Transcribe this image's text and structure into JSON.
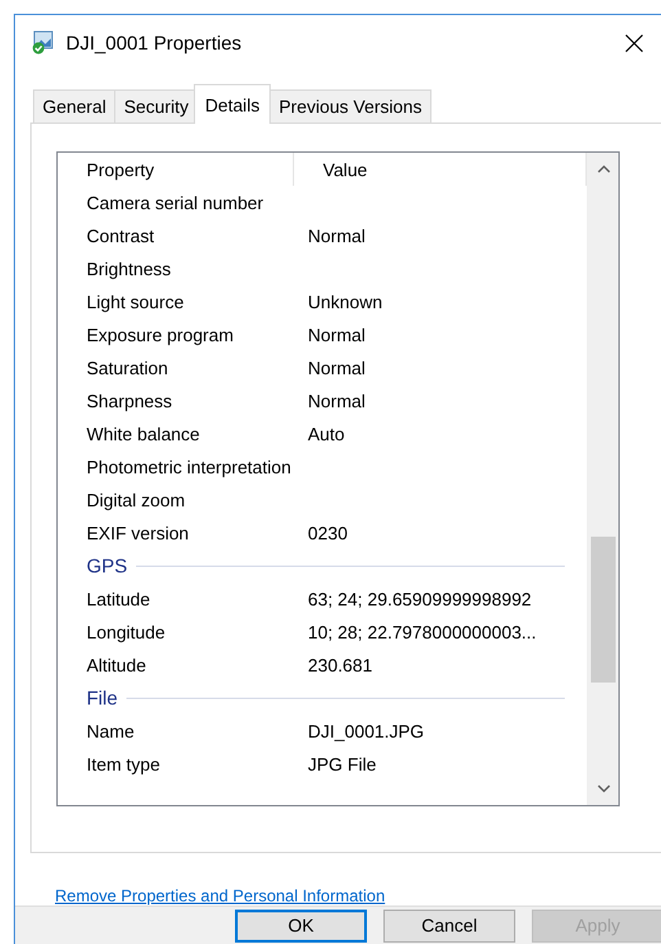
{
  "window": {
    "title": "DJI_0001 Properties"
  },
  "tabs": [
    {
      "label": "General",
      "selected": false
    },
    {
      "label": "Security",
      "selected": false
    },
    {
      "label": "Details",
      "selected": true
    },
    {
      "label": "Previous Versions",
      "selected": false
    }
  ],
  "details": {
    "columns": [
      "Property",
      "Value"
    ],
    "items": [
      {
        "kind": "row",
        "name": "Camera serial number"
      },
      {
        "kind": "row",
        "name": "Contrast",
        "value": "Normal"
      },
      {
        "kind": "row",
        "name": "Brightness"
      },
      {
        "kind": "row",
        "name": "Light source",
        "value": "Unknown"
      },
      {
        "kind": "row",
        "name": "Exposure program",
        "value": "Normal"
      },
      {
        "kind": "row",
        "name": "Saturation",
        "value": "Normal"
      },
      {
        "kind": "row",
        "name": "Sharpness",
        "value": "Normal"
      },
      {
        "kind": "row",
        "name": "White balance",
        "value": "Auto"
      },
      {
        "kind": "row",
        "name": "Photometric interpretation"
      },
      {
        "kind": "row",
        "name": "Digital zoom"
      },
      {
        "kind": "row",
        "name": "EXIF version",
        "value": "0230"
      },
      {
        "kind": "group",
        "label": "GPS"
      },
      {
        "kind": "row",
        "name": "Latitude",
        "value": "63; 24; 29.65909999998992"
      },
      {
        "kind": "row",
        "name": "Longitude",
        "value": "10; 28; 22.7978000000003..."
      },
      {
        "kind": "row",
        "name": "Altitude",
        "value": "230.681"
      },
      {
        "kind": "group",
        "label": "File"
      },
      {
        "kind": "row",
        "name": "Name",
        "value": "DJI_0001.JPG"
      },
      {
        "kind": "row",
        "name": "Item type",
        "value": "JPG File"
      }
    ]
  },
  "link": "Remove Properties and Personal Information",
  "buttons": [
    {
      "label": "OK",
      "focused": true,
      "disabled": false
    },
    {
      "label": "Cancel",
      "focused": false,
      "disabled": false
    },
    {
      "label": "Apply",
      "focused": false,
      "disabled": true
    }
  ]
}
